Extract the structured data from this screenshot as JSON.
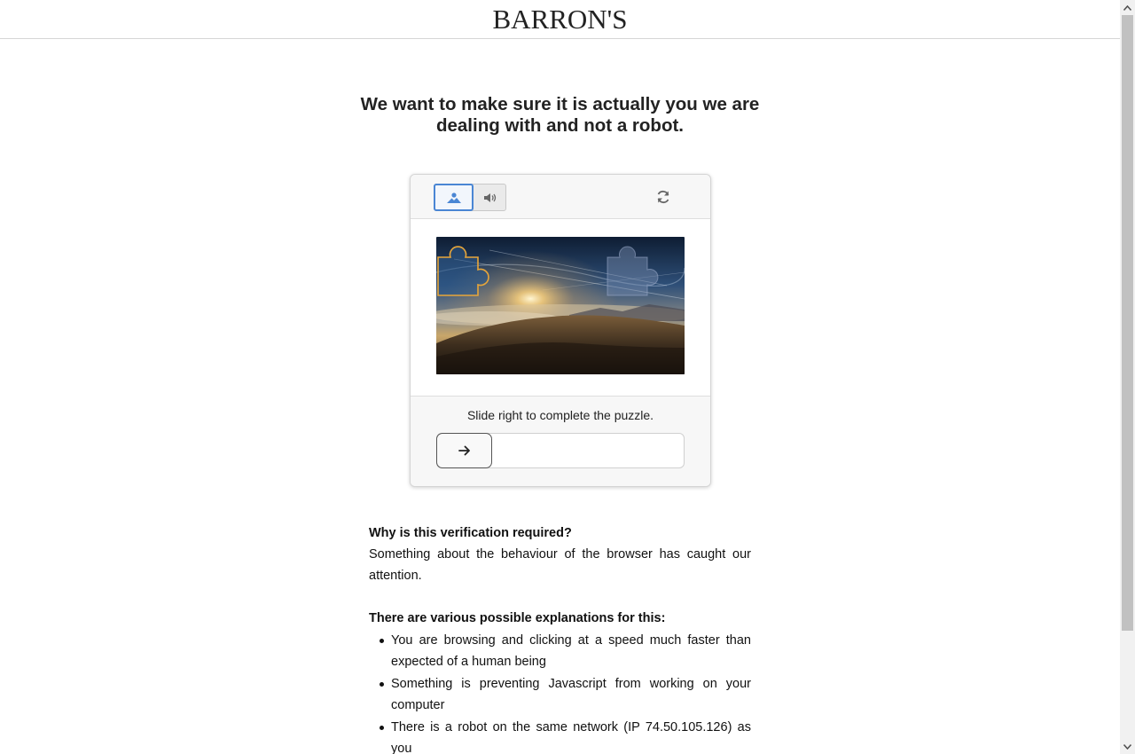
{
  "header": {
    "logo": "BARRON'S"
  },
  "headline": {
    "line1": "We want to make sure it is actually you we are",
    "line2": "dealing with and not a robot."
  },
  "captcha": {
    "modes": {
      "image_icon": "image-icon",
      "audio_icon": "speaker-icon"
    },
    "refresh_icon": "refresh-icon",
    "instruction": "Slide right to complete the puzzle.",
    "slider_icon": "arrow-right-icon",
    "slider_progress": 0,
    "accent_color": "#4a86d4"
  },
  "explanation": {
    "question": "Why is this verification required?",
    "answer": "Something about the behaviour of the browser has caught our attention.",
    "reasons_title": "There are various possible explanations for this:",
    "reasons": [
      "You are browsing and clicking at a speed much faster than expected of a human being",
      "Something is preventing Javascript from working on your computer",
      "There is a robot on the same network (IP 74.50.105.126) as you"
    ]
  }
}
